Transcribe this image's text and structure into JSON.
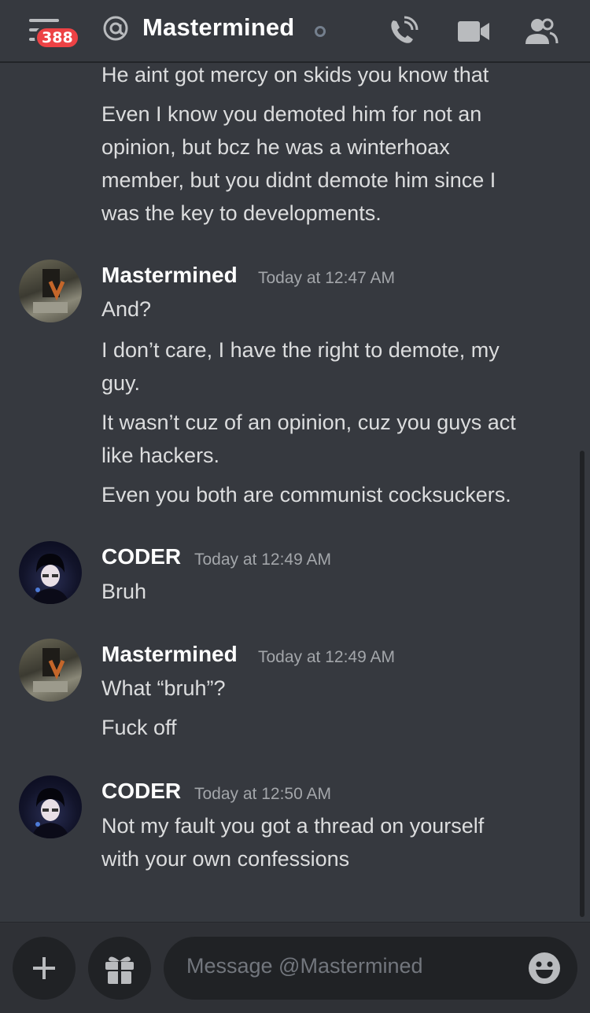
{
  "header": {
    "unread_count": "388",
    "channel_prefix": "@",
    "title": "Mastermined",
    "icons": [
      "menu-icon",
      "at-icon",
      "call-icon",
      "video-icon",
      "members-icon"
    ]
  },
  "messages": {
    "continued": [
      "He aint got mercy on skids you know that",
      "Even I know you demoted him for not an",
      "opinion, but bcz he was a winterhoax",
      "member, but you didnt demote him since I",
      "was the key to developments."
    ],
    "groups": [
      {
        "author": "Mastermined",
        "timestamp": "Today at 12:47 AM",
        "lines": [
          "And?",
          "I don’t care, I have the right to demote, my",
          "guy.",
          "It wasn’t cuz of an opinion, cuz you guys act",
          "like hackers.",
          "Even you both are communist cocksuckers."
        ]
      },
      {
        "author": "CODER",
        "timestamp": "Today at 12:49 AM",
        "lines": [
          "Bruh"
        ]
      },
      {
        "author": "Mastermined",
        "timestamp": "Today at 12:49 AM",
        "lines": [
          "What “bruh”?",
          "Fuck off"
        ]
      },
      {
        "author": "CODER",
        "timestamp": "Today at 12:50 AM",
        "lines": [
          "Not my fault you got a thread on yourself",
          "with your own confessions"
        ]
      }
    ]
  },
  "composer": {
    "placeholder": "Message @Mastermined",
    "icons": [
      "plus-icon",
      "gift-icon",
      "emoji-icon"
    ]
  },
  "colors": {
    "background": "#36393f",
    "badge": "#ed4245",
    "composer_bg": "#2f3136",
    "input_bg": "#202225"
  }
}
